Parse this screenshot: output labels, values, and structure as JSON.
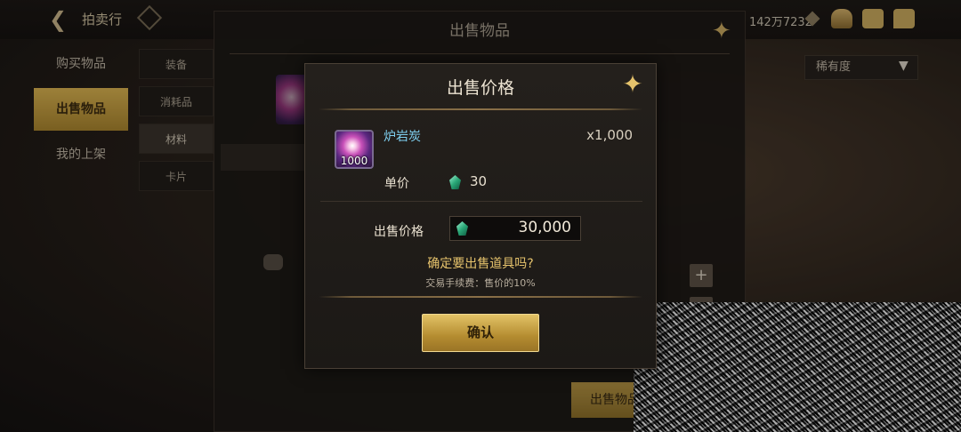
{
  "header": {
    "back_icon": "arrow-left-icon",
    "title": "拍卖行",
    "currency_text": "142万7232",
    "icons": [
      "treasure-box-icon",
      "mail-icon",
      "chat-icon"
    ]
  },
  "left_nav": {
    "items": [
      {
        "label": "购买物品",
        "active": false
      },
      {
        "label": "出售物品",
        "active": true
      },
      {
        "label": "我的上架",
        "active": false
      }
    ]
  },
  "sub_tabs": [
    {
      "label": "装备"
    },
    {
      "label": "消耗品"
    },
    {
      "label": "材料"
    },
    {
      "label": "卡片"
    }
  ],
  "background_panel": {
    "title": "出售物品",
    "rarity_select": "稀有度",
    "sell_button": "出售物品"
  },
  "dialog": {
    "title": "出售价格",
    "item": {
      "name": "炉岩炭",
      "quantity": "x1,000",
      "stack_count": "1000"
    },
    "unit_price_label": "单价",
    "unit_price_value": "30",
    "sell_price_label": "出售价格",
    "sell_price_value": "30,000",
    "confirm_question": "确定要出售道具吗?",
    "fee_note": "交易手续费：售价的10%",
    "confirm_button": "确认"
  },
  "colors": {
    "gold_accent": "#d9b250",
    "item_name": "#7fd0f0",
    "gem_green": "#2aa878"
  }
}
